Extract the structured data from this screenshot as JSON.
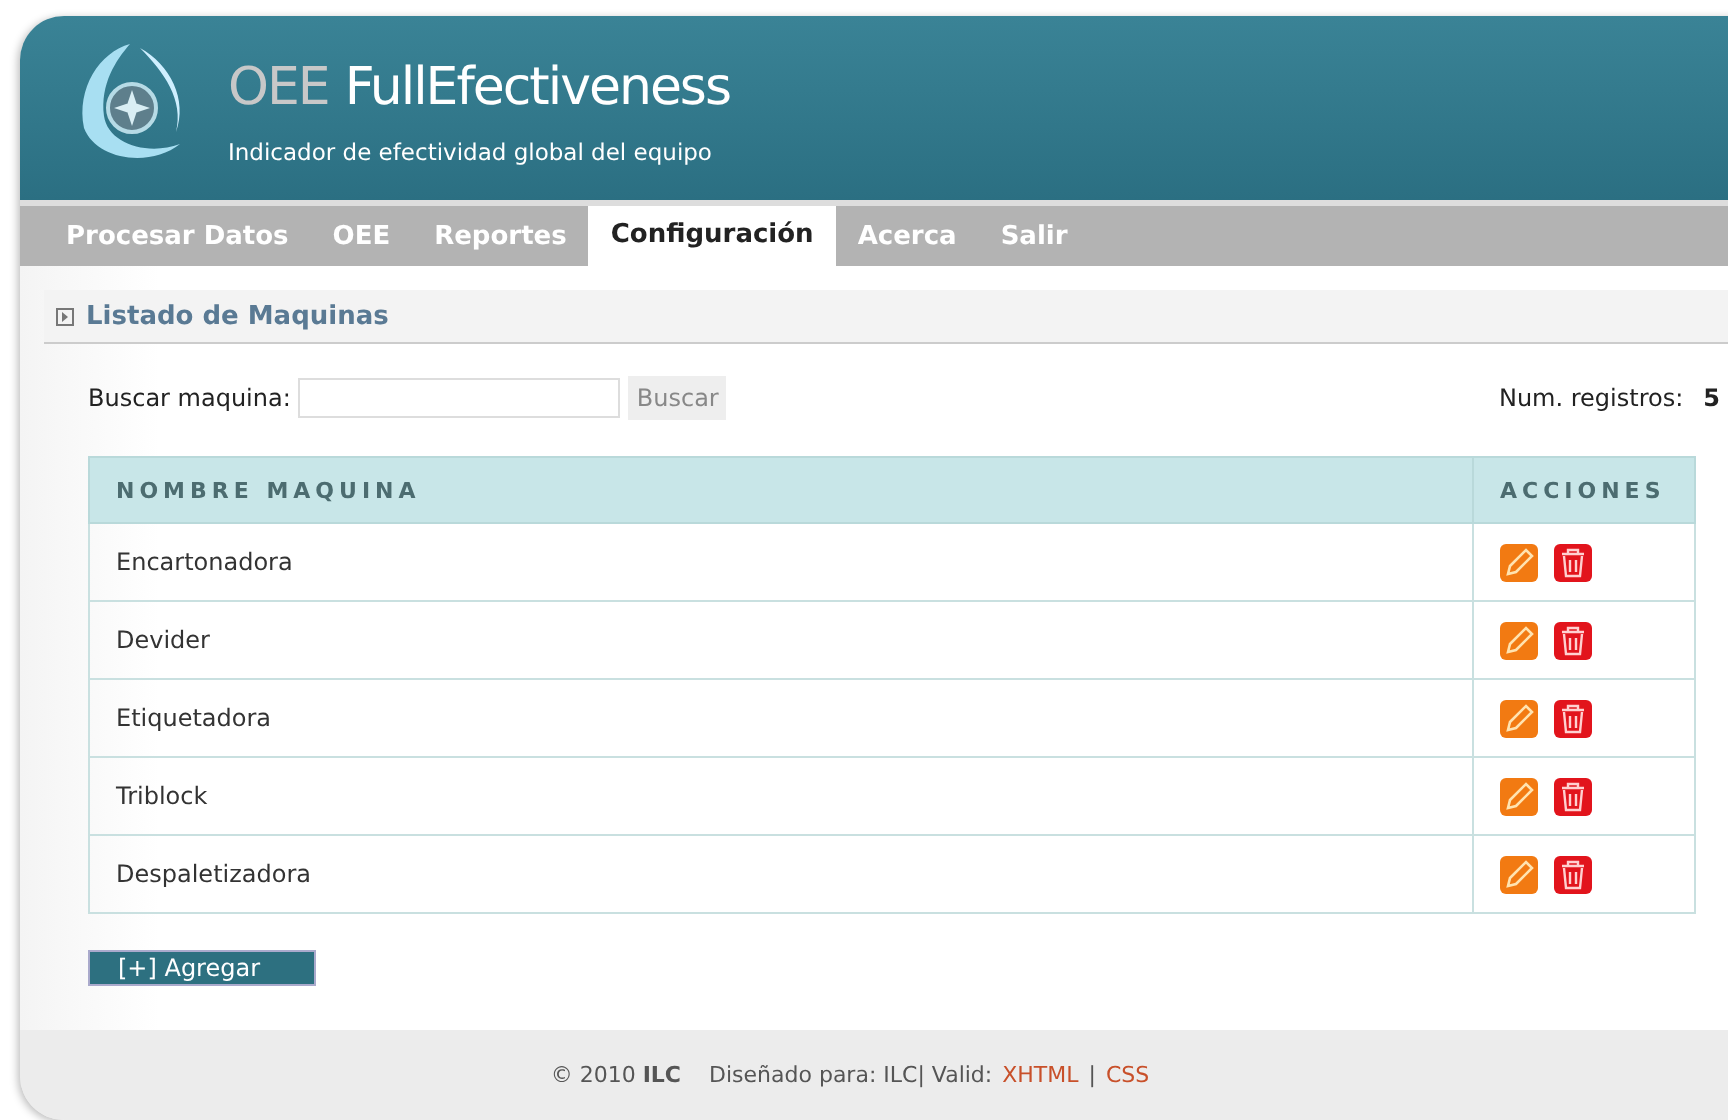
{
  "header": {
    "title_prefix": "OEE",
    "title": "FullEfectiveness",
    "subtitle": "Indicador de efectividad global del equipo"
  },
  "nav": [
    {
      "label": "Procesar Datos",
      "selected": false
    },
    {
      "label": "OEE",
      "selected": false
    },
    {
      "label": "Reportes",
      "selected": false
    },
    {
      "label": "Configuración",
      "selected": true
    },
    {
      "label": "Acerca",
      "selected": false
    },
    {
      "label": "Salir",
      "selected": false
    }
  ],
  "section": {
    "title": "Listado de Maquinas"
  },
  "search": {
    "label": "Buscar maquina:",
    "button": "Buscar",
    "count_label": "Num. registros:",
    "count": "5"
  },
  "table": {
    "columns": [
      "NOMBRE MAQUINA",
      "ACCIONES"
    ],
    "rows": [
      {
        "name": "Encartonadora"
      },
      {
        "name": "Devider"
      },
      {
        "name": "Etiquetadora"
      },
      {
        "name": "Triblock"
      },
      {
        "name": "Despaletizadora"
      }
    ]
  },
  "add_button": "[+] Agregar",
  "footer": {
    "copyright": "© 2010 **ILC**",
    "designed": "Diseñado para: ILC| Valid:",
    "links": [
      "XHTML",
      "CSS"
    ],
    "separator": "|"
  }
}
